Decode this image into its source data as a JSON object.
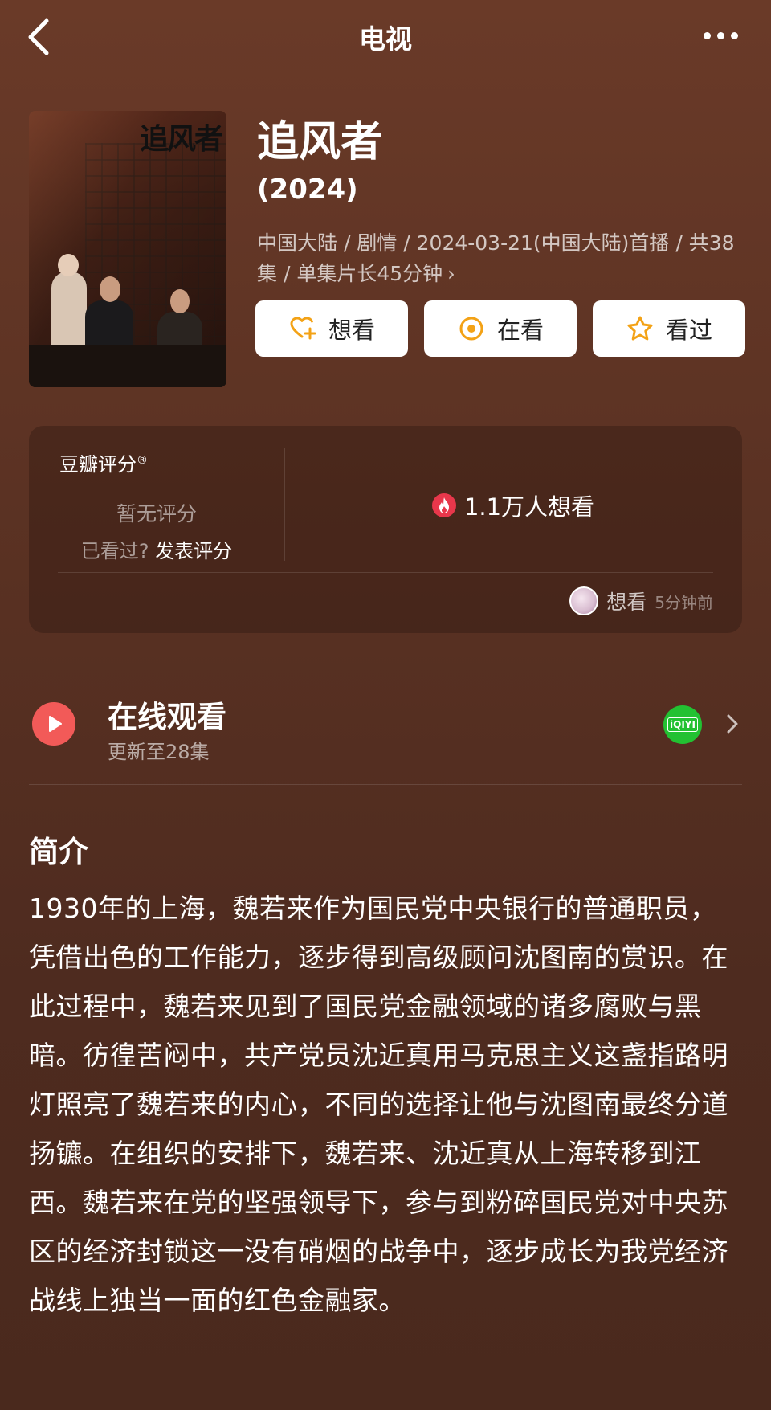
{
  "header": {
    "title": "电视"
  },
  "movie": {
    "poster_art_text": "追风者",
    "title": "追风者",
    "year": "(2024)",
    "meta": "中国大陆 / 剧情 / 2024-03-21(中国大陆)首播 / 共38集 / 单集片长45分钟"
  },
  "actions": [
    {
      "label": "想看",
      "icon": "heart-plus-icon",
      "color": "#f3a216"
    },
    {
      "label": "在看",
      "icon": "target-icon",
      "color": "#f3a216"
    },
    {
      "label": "看过",
      "icon": "star-icon",
      "color": "#f3a216"
    }
  ],
  "rating": {
    "brand": "豆瓣评分",
    "brand_mark": "®",
    "no_rating": "暂无评分",
    "seen_question": "已看过?",
    "post_rating": "发表评分",
    "wish_count": "1.1万人想看",
    "activity_label": "想看",
    "activity_time": "5分钟前"
  },
  "watch": {
    "title": "在线观看",
    "subtitle": "更新至28集",
    "platform_badge": "iQIYI"
  },
  "synopsis": {
    "heading": "简介",
    "body": "1930年的上海，魏若来作为国民党中央银行的普通职员，凭借出色的工作能力，逐步得到高级顾问沈图南的赏识。在此过程中，魏若来见到了国民党金融领域的诸多腐败与黑暗。彷徨苦闷中，共产党员沈近真用马克思主义这盏指路明灯照亮了魏若来的内心，不同的选择让他与沈图南最终分道扬镳。在组织的安排下，魏若来、沈近真从上海转移到江西。魏若来在党的坚强领导下，参与到粉碎国民党对中央苏区的经济封锁这一没有硝烟的战争中，逐步成长为我党经济战线上独当一面的红色金融家。"
  },
  "colors": {
    "background": "#5b3223",
    "accent": "#f3a216",
    "play": "#f25a58",
    "iqiyi": "#22c132",
    "fire": "#e8374b"
  }
}
